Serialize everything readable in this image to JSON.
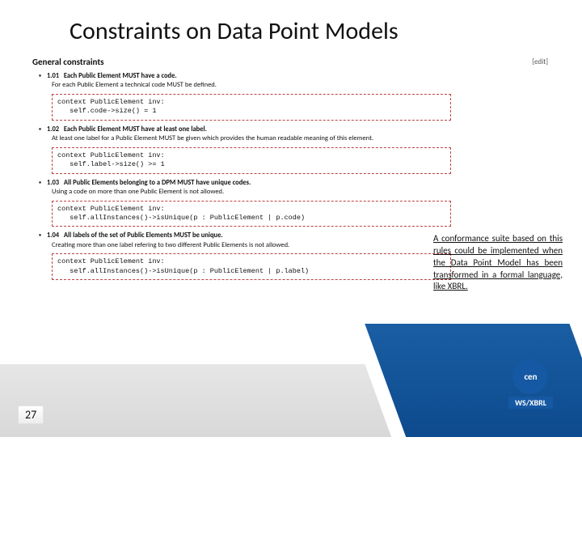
{
  "title": "Constraints on Data Point Models",
  "sectionHeading": "General constraints",
  "editLink": "[edit]",
  "pageNumber": "27",
  "rules": [
    {
      "num": "1.01",
      "title": "Each Public Element MUST have a code.",
      "desc": "For each Public Element a technical code MUST be defined.",
      "code": "context PublicElement inv:\n   self.code->size() = 1"
    },
    {
      "num": "1.02",
      "title": "Each Public Element MUST have at least one label.",
      "desc": "At least one label for a Public Element MUST be given which provides the human readable meaning of this element.",
      "code": "context PublicElement inv:\n   self.label->size() >= 1"
    },
    {
      "num": "1.03",
      "title": "All Public Elements belonging to a DPM MUST have unique codes.",
      "desc": "Using a code on more than one Public Element is not allowed.",
      "code": "context PublicElement inv:\n   self.allInstances()->isUnique(p : PublicElement | p.code)"
    },
    {
      "num": "1.04",
      "title": "All labels of the set of Public Elements MUST be unique.",
      "desc": "Creating more than one label refering to two different Public Elements is not allowed.",
      "code": "context PublicElement inv:\n   self.allInstances()->isUnique(p : PublicElement | p.label)"
    }
  ],
  "callout": "A conformance suite based on this rules could be implemented when the Data Point Model has been transformed in a formal language, like XBRL.",
  "logo": {
    "text": "cen",
    "bar": "WS/XBRL"
  }
}
